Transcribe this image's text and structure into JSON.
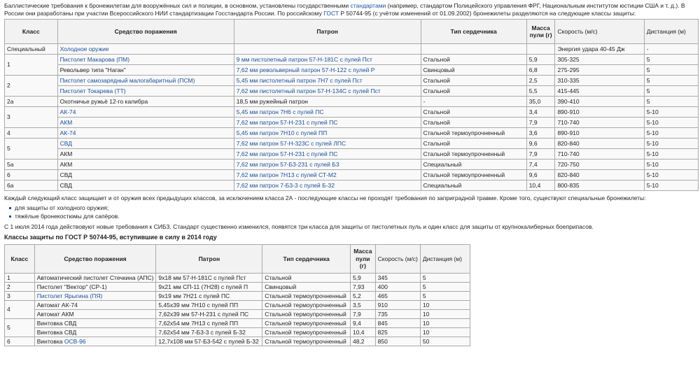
{
  "intro": {
    "t1": "Баллистические требования к бронежилетам для вооружённых сил и полиции, в основном, установлены государственными ",
    "l1": "стандартами",
    "t2": " (например, стандартом Полицейского управления ФРГ, Национальным институтом юстиции США и т. д.). В России они разработаны при участии Всероссийского НИИ стандартизации Госстандарта России. По российскому ",
    "l2": "ГОСТ",
    "t3": " Р 50744-95 (с учётом изменений от 01.09.2002) бронежилеты разделяются на следующие классы защиты:"
  },
  "table1": {
    "headers": [
      "Класс",
      "Средство поражения",
      "Патрон",
      "Тип сердечника",
      "Масса пули (г)",
      "Скорость (м/с)",
      "Дистанция (м)"
    ],
    "rows": [
      {
        "cls": "Специальный",
        "weapon": "Холодное оружие",
        "weapon_link": true,
        "cartridge": "",
        "core": "",
        "mass": "",
        "speed": "Энергия удара 40-45 Дж",
        "dist": "-"
      },
      {
        "cls": "1",
        "weapon": "Пистолет Макарова (ПМ)",
        "weapon_link": true,
        "cartridge": "9 мм пистолетный патрон 57-Н-181С с пулей Пст",
        "core": "Стальной",
        "mass": "5,9",
        "speed": "305-325",
        "dist": "5"
      },
      {
        "cls": "",
        "weapon": "Револьвер типа \"Наган\"",
        "weapon_link": false,
        "cartridge": "7,62 мм револьверный патрон 57-Н-122 с пулей Р",
        "core": "Свинцовый",
        "mass": "6,8",
        "speed": "275-295",
        "dist": "5"
      },
      {
        "cls": "2",
        "weapon": "Пистолет самозарядный малогабаритный (ПСМ)",
        "weapon_link": true,
        "cartridge": "5,45 мм пистолетный патрон 7Н7 с пулей Пст",
        "core": "Стальной",
        "mass": "2,5",
        "speed": "310-335",
        "dist": "5"
      },
      {
        "cls": "",
        "weapon": "Пистолет Токарева (ТТ)",
        "weapon_link": true,
        "cartridge": "7,62 мм пистолетный патрон 57-Н-134С с пулей Пст",
        "core": "Стальной",
        "mass": "5,5",
        "speed": "415-445",
        "dist": "5"
      },
      {
        "cls": "2а",
        "weapon": "Охотничье ружьё 12-го калибра",
        "weapon_link": false,
        "cartridge": "18,5 мм ружейный патрон",
        "core": "-",
        "mass": "35,0",
        "speed": "390-410",
        "dist": "5"
      },
      {
        "cls": "3",
        "weapon": "АК-74",
        "weapon_link": true,
        "cartridge": "5,45 мм патрон 7Н6 с пулей ПС",
        "core": "Стальной",
        "mass": "3,4",
        "speed": "890-910",
        "dist": "5-10"
      },
      {
        "cls": "",
        "weapon": "АКМ",
        "weapon_link": true,
        "cartridge": "7,62 мм патрон 57-Н-231 с пулей ПС",
        "core": "Стальной",
        "mass": "7,9",
        "speed": "710-740",
        "dist": "5-10"
      },
      {
        "cls": "4",
        "weapon": "АК-74",
        "weapon_link": true,
        "cartridge": "5,45 мм патрон 7Н10 с пулей ПП",
        "core": "Стальной термоупрочненный",
        "mass": "3,6",
        "speed": "890-910",
        "dist": "5-10"
      },
      {
        "cls": "5",
        "weapon": "СВД",
        "weapon_link": true,
        "cartridge": "7,62 мм патрон 57-Н-323С с пулей ЛПС",
        "core": "Стальной",
        "mass": "9,6",
        "speed": "820-840",
        "dist": "5-10"
      },
      {
        "cls": "",
        "weapon": "АКМ",
        "weapon_link": false,
        "cartridge": "7,62 мм патрон 57-Н-231 с пулей ПС",
        "core": "Стальной термоупрочненный",
        "mass": "7,9",
        "speed": "710-740",
        "dist": "5-10"
      },
      {
        "cls": "5а",
        "weapon": "АКМ",
        "weapon_link": false,
        "cartridge": "7,62 мм патрон 57-Б3-231 с пулей Б3",
        "core": "Специальный",
        "mass": "7,4",
        "speed": "720-750",
        "dist": "5-10"
      },
      {
        "cls": "6",
        "weapon": "СВД",
        "weapon_link": false,
        "cartridge": "7,62 мм патрон 7Н13 с пулей СТ-М2",
        "core": "Стальной термоупрочненный",
        "mass": "9,6",
        "speed": "820-840",
        "dist": "5-10"
      },
      {
        "cls": "6а",
        "weapon": "СВД",
        "weapon_link": false,
        "cartridge": "7,62 мм патрон 7-Б3-3 с пулей Б-32",
        "core": "Специальный",
        "mass": "10,4",
        "speed": "800-835",
        "dist": "5-10"
      }
    ]
  },
  "after1": "Каждый следующий класс защищает и от оружия всех предыдущих классов, за исключением класса 2А - последующие классы не проходят требования по заприградной травме. Кроме того, существуют специальные бронежилеты:",
  "bullets": [
    "для защиты от холодного оружия;",
    "тяжёлые бронекостюмы для сапёров."
  ],
  "para2": "С 1 июля 2014 года действовуют новые требования к СИБЗ. Стандарт существенно изменился, появятся три класса для защиты от пистолетных пуль и один класс для защиты от крупнокалиберных боеприпасов.",
  "heading2": "Классы защиты по ГОСТ Р 50744-95, вступившие в силу в 2014 году",
  "table2": {
    "headers": [
      "Класс",
      "Средство поражения",
      "Патрон",
      "Тип сердечника",
      "Масса пули (г)",
      "Скорость (м/с)",
      "Дистанция (м)"
    ],
    "rows": [
      {
        "cls": "1",
        "w1": "Автоматический пистолет Стечкина (АПС)",
        "w2": "",
        "cartridge": "9х18 мм 57-Н-181С с пулей Пст",
        "core": "Стальной",
        "mass": "5,9",
        "speed": "345",
        "dist": "5"
      },
      {
        "cls": "2",
        "w1": "Пистолет \"Вектор\" (СР-1)",
        "w2": "",
        "cartridge": "9х21 мм СП-11 (7Н28) с пулей П",
        "core": "Свинцовый",
        "mass": "7,93",
        "speed": "400",
        "dist": "5"
      },
      {
        "cls": "3",
        "w1": "Пистолет Ярыгина (ПЯ)",
        "w2": "",
        "cartridge": "9х19 мм 7Н21 с пулей ПС",
        "core": "Стальной термоупрочненный",
        "mass": "5,2",
        "speed": "465",
        "dist": "5"
      },
      {
        "cls": "4",
        "w1": "Автомат АК-74",
        "w2": "",
        "cartridge": "5,45х39 мм 7Н10 с пулей ПП",
        "core": "Стальной термоупрочненный",
        "mass": "3,5",
        "speed": "910",
        "dist": "10"
      },
      {
        "cls": "",
        "w1": "Автомат АКМ",
        "w2": "",
        "cartridge": "7,62х39 мм 57-Н-231 с пулей ПС",
        "core": "Стальной термоупрочненный",
        "mass": "7,9",
        "speed": "735",
        "dist": "10"
      },
      {
        "cls": "5",
        "w1": "Винтовка СВД",
        "w2": "",
        "cartridge": "7,62х54 мм 7Н13 с пулей ПП",
        "core": "Стальной термоупрочненный",
        "mass": "9,4",
        "speed": "845",
        "dist": "10"
      },
      {
        "cls": "",
        "w1": "Винтовка СВД",
        "w2": "",
        "cartridge": "7,62х54 мм 7-Б3-3 с пулей Б-32",
        "core": "Стальной термоупрочненный",
        "mass": "10,4",
        "speed": "825",
        "dist": "10"
      },
      {
        "cls": "6",
        "w1": "Винтовка ",
        "w2": "ОСВ-96",
        "cartridge": "12,7х108 мм 57-Б3-542 с пулей Б-32",
        "core": "Стальной термоупрочненный",
        "mass": "48,2",
        "speed": "850",
        "dist": "50"
      }
    ]
  },
  "colors": {
    "link": "#1a4f9c",
    "header_bg": "#f2f2f2",
    "table_bg": "#f9f9f9",
    "border": "#aaaaaa"
  }
}
